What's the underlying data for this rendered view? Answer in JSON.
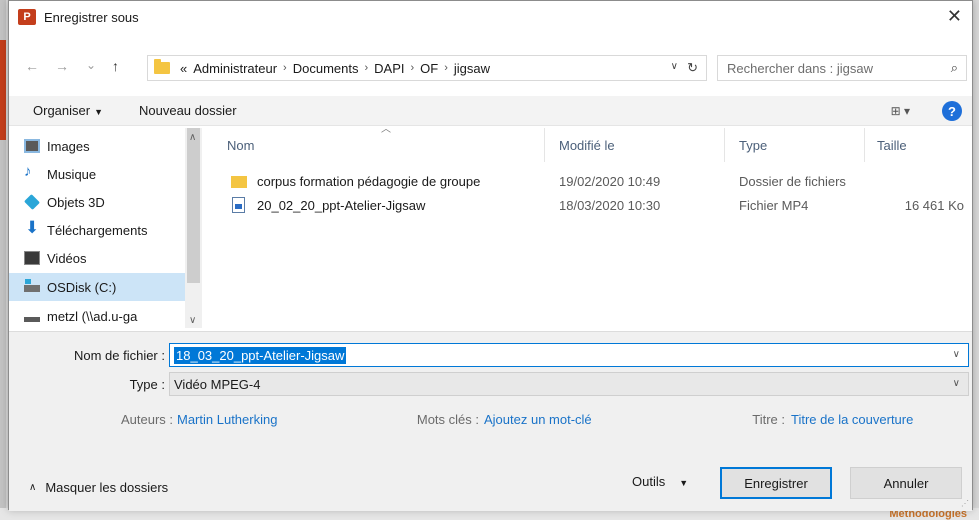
{
  "background": {
    "partial_text": "Méthodologies"
  },
  "window": {
    "app_icon": "P",
    "title": "Enregistrer sous",
    "close": "✕"
  },
  "nav": {
    "back": "←",
    "forward": "→",
    "recent": "⌄",
    "up": "↑"
  },
  "address": {
    "breadcrumb": [
      "«",
      "Administrateur",
      "Documents",
      "DAPI",
      "OF",
      "jigsaw"
    ],
    "separator": "›",
    "dropdown": "∨",
    "refresh": "↻"
  },
  "search": {
    "placeholder": "Rechercher dans : jigsaw",
    "icon": "⌕"
  },
  "toolbar": {
    "organize_label": "Organiser",
    "new_folder_label": "Nouveau dossier",
    "view_icon": "⊞ ▾",
    "help": "?"
  },
  "sidebar": {
    "items": [
      {
        "label": "Images",
        "icon": "images-icon"
      },
      {
        "label": "Musique",
        "icon": "music-icon"
      },
      {
        "label": "Objets 3D",
        "icon": "objects-3d-icon"
      },
      {
        "label": "Téléchargements",
        "icon": "download-icon"
      },
      {
        "label": "Vidéos",
        "icon": "videos-icon"
      },
      {
        "label": "OSDisk (C:)",
        "icon": "disk-icon",
        "selected": true
      },
      {
        "label": "metzl (\\\\ad.u-ga",
        "icon": "network-drive-icon"
      }
    ]
  },
  "filelist": {
    "columns": [
      "Nom",
      "Modifié le",
      "Type",
      "Taille"
    ],
    "sort_indicator": "︿",
    "rows": [
      {
        "name": "corpus formation pédagogie de groupe",
        "modified": "19/02/2020 10:49",
        "type": "Dossier de fichiers",
        "size": "",
        "icon": "folder-icon"
      },
      {
        "name": "20_02_20_ppt-Atelier-Jigsaw",
        "modified": "18/03/2020 10:30",
        "type": "Fichier MP4",
        "size": "16 461 Ko",
        "icon": "document-icon"
      }
    ]
  },
  "form": {
    "filename_label": "Nom de fichier :",
    "filename_value": "18_03_20_ppt-Atelier-Jigsaw",
    "type_label": "Type :",
    "type_value": "Vidéo MPEG-4",
    "authors_label": "Auteurs :",
    "authors_value": "Martin Lutherking",
    "keywords_label": "Mots clés :",
    "keywords_value": "Ajoutez un mot-clé",
    "title_label": "Titre :",
    "title_value": "Titre de la couverture"
  },
  "footer": {
    "hide_folders_label": "Masquer les dossiers",
    "tools_label": "Outils",
    "save_label": "Enregistrer",
    "cancel_label": "Annuler"
  },
  "colors": {
    "accent": "#0078d7",
    "selection": "#cce4f7",
    "app_red": "#c43e1c",
    "link": "#1a73c8"
  }
}
